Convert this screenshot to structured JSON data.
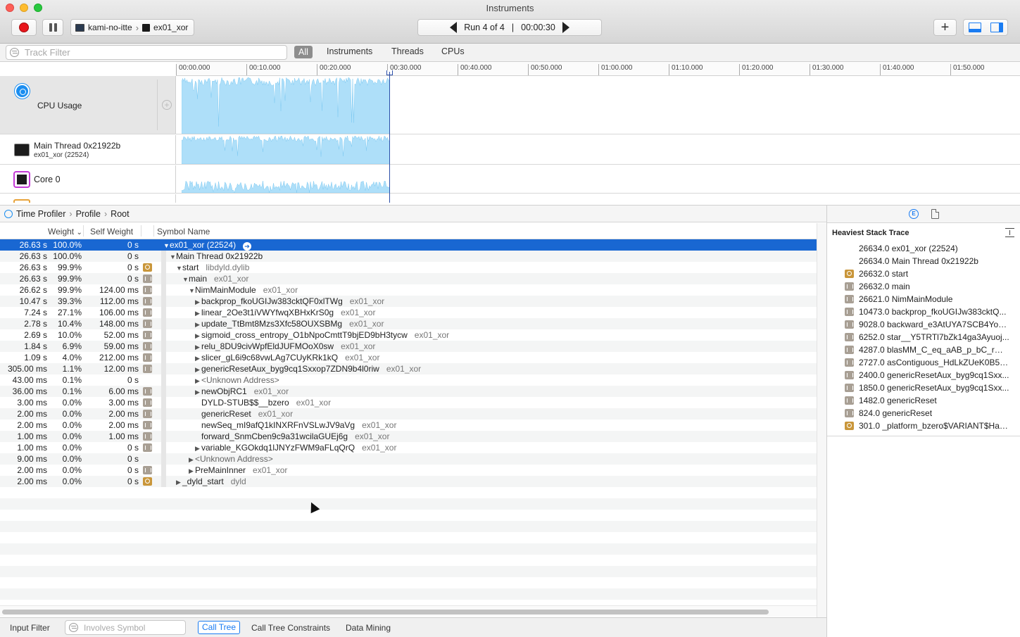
{
  "window": {
    "title": "Instruments"
  },
  "toolbar": {
    "target_device": "kami-no-itte",
    "target_process": "ex01_xor",
    "run_label": "Run 4 of 4",
    "run_sep": "|",
    "run_time": "00:00:30",
    "plus": "+"
  },
  "filterbar": {
    "placeholder": "Track Filter",
    "scopes": [
      "All",
      "Instruments",
      "Threads",
      "CPUs"
    ]
  },
  "ruler": [
    "00:00.000",
    "00:10.000",
    "00:20.000",
    "00:30.000",
    "00:40.000",
    "00:50.000",
    "01:00.000",
    "01:10.000",
    "01:20.000",
    "01:30.000",
    "01:40.000",
    "01:50.000"
  ],
  "tracks": {
    "cpu": {
      "label": "CPU Usage",
      "add": "+"
    },
    "thread": {
      "label": "Main Thread  0x21922b",
      "sub": "ex01_xor (22524)"
    },
    "core": {
      "label": "Core 0"
    }
  },
  "pathbar": {
    "items": [
      "Time Profiler",
      "Profile",
      "Root"
    ],
    "sep": "›"
  },
  "columns": {
    "weight": "Weight",
    "self": "Self Weight",
    "symbol": "Symbol Name",
    "sort_indicator": "⌄"
  },
  "calltree": [
    {
      "w": "26.63 s",
      "p": "100.0%",
      "s": "0 s",
      "icon": "none",
      "depth": 0,
      "disc": "▼",
      "name": "ex01_xor (22524)",
      "lib": "",
      "sel": true
    },
    {
      "w": "26.63 s",
      "p": "100.0%",
      "s": "0 s",
      "icon": "none",
      "depth": 1,
      "disc": "▼",
      "name": "Main Thread  0x21922b",
      "lib": ""
    },
    {
      "w": "26.63 s",
      "p": "99.9%",
      "s": "0 s",
      "icon": "gear",
      "depth": 2,
      "disc": "▼",
      "name": "start",
      "lib": "libdyld.dylib"
    },
    {
      "w": "26.63 s",
      "p": "99.9%",
      "s": "0 s",
      "icon": "lib",
      "depth": 3,
      "disc": "▼",
      "name": "main",
      "lib": "ex01_xor"
    },
    {
      "w": "26.62 s",
      "p": "99.9%",
      "s": "124.00 ms",
      "icon": "lib",
      "depth": 4,
      "disc": "▼",
      "name": "NimMainModule",
      "lib": "ex01_xor"
    },
    {
      "w": "10.47 s",
      "p": "39.3%",
      "s": "112.00 ms",
      "icon": "lib",
      "depth": 5,
      "disc": "▶",
      "name": "backprop_fkoUGIJw383cktQF0xlTWg",
      "lib": "ex01_xor"
    },
    {
      "w": "7.24 s",
      "p": "27.1%",
      "s": "106.00 ms",
      "icon": "lib",
      "depth": 5,
      "disc": "▶",
      "name": "linear_2Oe3t1iVWYfwqXBHxKrS0g",
      "lib": "ex01_xor"
    },
    {
      "w": "2.78 s",
      "p": "10.4%",
      "s": "148.00 ms",
      "icon": "lib",
      "depth": 5,
      "disc": "▶",
      "name": "update_TtBmt8Mzs3Xfc58OUXSBMg",
      "lib": "ex01_xor"
    },
    {
      "w": "2.69 s",
      "p": "10.0%",
      "s": "52.00 ms",
      "icon": "lib",
      "depth": 5,
      "disc": "▶",
      "name": "sigmoid_cross_entropy_O1bNpoCmttT9bjED9bH3tycw",
      "lib": "ex01_xor"
    },
    {
      "w": "1.84 s",
      "p": "6.9%",
      "s": "59.00 ms",
      "icon": "lib",
      "depth": 5,
      "disc": "▶",
      "name": "relu_8DU9civWpfEldJUFMOoX0sw",
      "lib": "ex01_xor"
    },
    {
      "w": "1.09 s",
      "p": "4.0%",
      "s": "212.00 ms",
      "icon": "lib",
      "depth": 5,
      "disc": "▶",
      "name": "slicer_gL6i9c68vwLAg7CUyKRk1kQ",
      "lib": "ex01_xor"
    },
    {
      "w": "305.00 ms",
      "p": "1.1%",
      "s": "12.00 ms",
      "icon": "lib",
      "depth": 5,
      "disc": "▶",
      "name": "genericResetAux_byg9cq1Sxxop7ZDN9b4l0riw",
      "lib": "ex01_xor"
    },
    {
      "w": "43.00 ms",
      "p": "0.1%",
      "s": "0 s",
      "icon": "none",
      "depth": 5,
      "disc": "▶",
      "name": "<Unknown Address>",
      "lib": "",
      "dim": true
    },
    {
      "w": "36.00 ms",
      "p": "0.1%",
      "s": "6.00 ms",
      "icon": "lib",
      "depth": 5,
      "disc": "▶",
      "name": "newObjRC1",
      "lib": "ex01_xor"
    },
    {
      "w": "3.00 ms",
      "p": "0.0%",
      "s": "3.00 ms",
      "icon": "lib",
      "depth": 5,
      "disc": "",
      "name": "DYLD-STUB$$__bzero",
      "lib": "ex01_xor"
    },
    {
      "w": "2.00 ms",
      "p": "0.0%",
      "s": "2.00 ms",
      "icon": "lib",
      "depth": 5,
      "disc": "",
      "name": "genericReset",
      "lib": "ex01_xor"
    },
    {
      "w": "2.00 ms",
      "p": "0.0%",
      "s": "2.00 ms",
      "icon": "lib",
      "depth": 5,
      "disc": "",
      "name": "newSeq_mI9afQ1kINXRFnVSLwJV9aVg",
      "lib": "ex01_xor"
    },
    {
      "w": "1.00 ms",
      "p": "0.0%",
      "s": "1.00 ms",
      "icon": "lib",
      "depth": 5,
      "disc": "",
      "name": "forward_SnmCben9c9a31wcilaGUEj6g",
      "lib": "ex01_xor"
    },
    {
      "w": "1.00 ms",
      "p": "0.0%",
      "s": "0 s",
      "icon": "lib",
      "depth": 5,
      "disc": "▶",
      "name": "variable_KGOkdq1lJNYzFWM9aFLqQrQ",
      "lib": "ex01_xor"
    },
    {
      "w": "9.00 ms",
      "p": "0.0%",
      "s": "0 s",
      "icon": "none",
      "depth": 4,
      "disc": "▶",
      "name": "<Unknown Address>",
      "lib": "",
      "dim": true
    },
    {
      "w": "2.00 ms",
      "p": "0.0%",
      "s": "0 s",
      "icon": "lib",
      "depth": 4,
      "disc": "▶",
      "name": "PreMainInner",
      "lib": "ex01_xor"
    },
    {
      "w": "2.00 ms",
      "p": "0.0%",
      "s": "0 s",
      "icon": "gear",
      "depth": 2,
      "disc": "▶",
      "name": "_dyld_start",
      "lib": "dyld"
    }
  ],
  "inspector": {
    "title": "Heaviest Stack Trace",
    "ext_icon": "E",
    "stack": [
      {
        "icon": "none",
        "text": "26634.0  ex01_xor (22524)"
      },
      {
        "icon": "none",
        "text": "26634.0  Main Thread  0x21922b"
      },
      {
        "icon": "gear",
        "text": "26632.0  start"
      },
      {
        "icon": "lib",
        "text": "26632.0  main"
      },
      {
        "icon": "lib",
        "text": "26621.0  NimMainModule"
      },
      {
        "icon": "lib",
        "text": "10473.0  backprop_fkoUGIJw383cktQ..."
      },
      {
        "icon": "lib",
        "text": "9028.0  backward_e3AtUYA7SCB4YoK..."
      },
      {
        "icon": "lib",
        "text": "6252.0  star__Y5TRTl7bZk14ga3Ayuoj..."
      },
      {
        "icon": "lib",
        "text": "4287.0  blasMM_C_eq_aAB_p_bC_rWHB..."
      },
      {
        "icon": "lib",
        "text": "2727.0  asContiguous_HdLkZUeK0B5v..."
      },
      {
        "icon": "lib",
        "text": "2400.0  genericResetAux_byg9cq1Sxx..."
      },
      {
        "icon": "lib",
        "text": "1850.0  genericResetAux_byg9cq1Sxx..."
      },
      {
        "icon": "lib",
        "text": "1482.0  genericReset"
      },
      {
        "icon": "lib",
        "text": "824.0  genericReset"
      },
      {
        "icon": "gear",
        "text": "301.0  _platform_bzero$VARIANT$Has..."
      }
    ]
  },
  "bottombar": {
    "input_filter": "Input Filter",
    "symbol_placeholder": "Involves Symbol",
    "call_tree": "Call Tree",
    "constraints": "Call Tree Constraints",
    "data_mining": "Data Mining"
  },
  "colors": {
    "accent": "#1a7cf2",
    "selection": "#1967d2",
    "cpu_fill": "#aedff9",
    "record": "#e8161c"
  }
}
